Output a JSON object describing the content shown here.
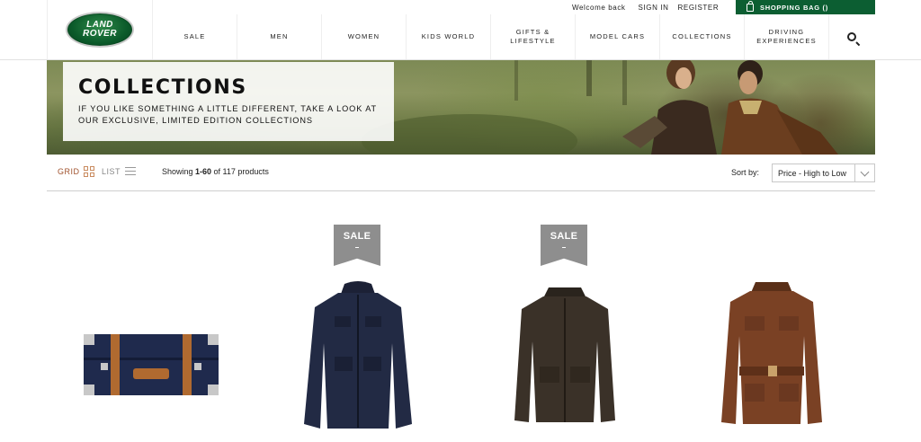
{
  "brand": {
    "logo_line1": "LAND",
    "logo_line2": "ROVER"
  },
  "utility": {
    "welcome": "Welcome back",
    "sign_in": "SIGN IN",
    "register": "REGISTER",
    "bag_label": "SHOPPING BAG ()"
  },
  "nav": {
    "items": [
      {
        "label": "SALE"
      },
      {
        "label": "MEN"
      },
      {
        "label": "WOMEN"
      },
      {
        "label": "KIDS WORLD"
      },
      {
        "label": "GIFTS &\nLIFESTYLE"
      },
      {
        "label": "MODEL CARS"
      },
      {
        "label": "COLLECTIONS"
      },
      {
        "label": "DRIVING\nEXPERIENCES"
      }
    ]
  },
  "banner": {
    "title": "COLLECTIONS",
    "subtitle": "IF YOU LIKE SOMETHING A LITTLE DIFFERENT, TAKE A LOOK AT OUR EXCLUSIVE, LIMITED EDITION COLLECTIONS"
  },
  "toolbar": {
    "grid_label": "GRID",
    "list_label": "LIST",
    "showing_prefix": "Showing ",
    "showing_range": "1-60",
    "showing_suffix": " of 117 products",
    "sort_label": "Sort by:",
    "sort_value": "Price - High to Low"
  },
  "products": [
    {
      "name": "Navy suitcase with tan leather straps",
      "sale": false
    },
    {
      "name": "Navy waxed hooded jacket",
      "sale": true,
      "badge": "SALE"
    },
    {
      "name": "Dark brown waxed jacket",
      "sale": true,
      "badge": "SALE"
    },
    {
      "name": "Brown leather belted jacket",
      "sale": false
    }
  ],
  "colors": {
    "brand_green": "#0c5e32",
    "sale_badge": "#8e8e8e",
    "grid_accent": "#a0522d"
  }
}
